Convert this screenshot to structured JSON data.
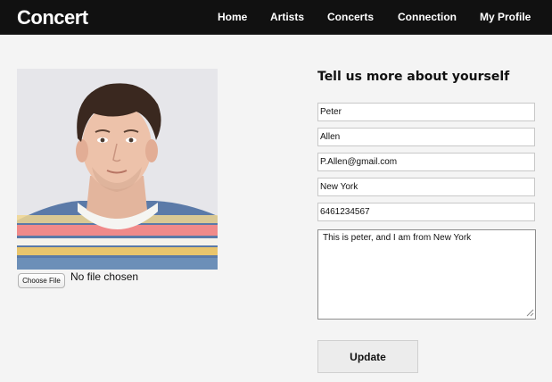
{
  "header": {
    "brand": "Concert",
    "nav": [
      {
        "label": "Home"
      },
      {
        "label": "Artists"
      },
      {
        "label": "Concerts"
      },
      {
        "label": "Connection"
      },
      {
        "label": "My Profile"
      }
    ]
  },
  "profile": {
    "file_button": "Choose File",
    "file_status": "No file chosen"
  },
  "form": {
    "title": "Tell us more about yourself",
    "first_name": "Peter",
    "last_name": "Allen",
    "email": "P.Allen@gmail.com",
    "city": "New York",
    "phone": "6461234567",
    "about": "This is peter, and I am from New York",
    "update_label": "Update"
  }
}
